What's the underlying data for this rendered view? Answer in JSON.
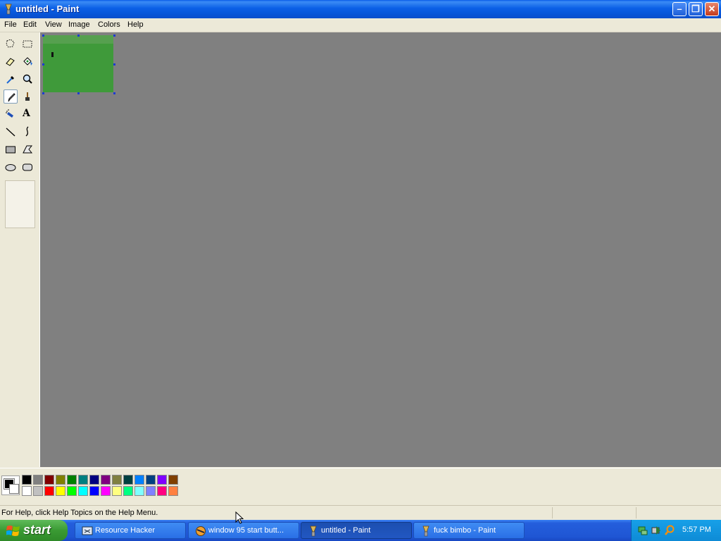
{
  "window": {
    "title": "untitled - Paint",
    "minimize_glyph": "–",
    "restore_glyph": "❐",
    "close_glyph": "✕"
  },
  "menu": [
    "File",
    "Edit",
    "View",
    "Image",
    "Colors",
    "Help"
  ],
  "tools": [
    {
      "name": "free-form-select",
      "icon": "free-form-select-icon"
    },
    {
      "name": "select",
      "icon": "rectangle-select-icon"
    },
    {
      "name": "eraser",
      "icon": "eraser-icon"
    },
    {
      "name": "fill",
      "icon": "paint-bucket-icon"
    },
    {
      "name": "pick-color",
      "icon": "eyedropper-icon"
    },
    {
      "name": "magnifier",
      "icon": "magnifier-icon"
    },
    {
      "name": "pencil",
      "icon": "pencil-icon",
      "selected": true
    },
    {
      "name": "brush",
      "icon": "brush-icon"
    },
    {
      "name": "airbrush",
      "icon": "airbrush-icon"
    },
    {
      "name": "text",
      "icon": "text-icon",
      "glyph": "A"
    },
    {
      "name": "line",
      "icon": "line-icon"
    },
    {
      "name": "curve",
      "icon": "curve-icon"
    },
    {
      "name": "rectangle",
      "icon": "rectangle-icon"
    },
    {
      "name": "polygon",
      "icon": "polygon-icon"
    },
    {
      "name": "ellipse",
      "icon": "ellipse-icon"
    },
    {
      "name": "rounded-rectangle",
      "icon": "rounded-rectangle-icon"
    }
  ],
  "colors": {
    "foreground": "#000000",
    "background": "#ffffff",
    "canvas_fill": "#3f9a3a",
    "workspace": "#808080",
    "palette_top": [
      "#000000",
      "#808080",
      "#800000",
      "#808000",
      "#008000",
      "#008080",
      "#000080",
      "#800080",
      "#808040",
      "#004040",
      "#0080ff",
      "#004080",
      "#8000ff",
      "#804000"
    ],
    "palette_bottom": [
      "#ffffff",
      "#c0c0c0",
      "#ff0000",
      "#ffff00",
      "#00ff00",
      "#00ffff",
      "#0000ff",
      "#ff00ff",
      "#ffff80",
      "#00ff80",
      "#80ffff",
      "#8080ff",
      "#ff0080",
      "#ff8040"
    ]
  },
  "status": {
    "help_text": "For Help, click Help Topics on the Help Menu."
  },
  "taskbar": {
    "start_label": "start",
    "tasks": [
      {
        "label": "Resource Hacker",
        "icon": "resource-hacker-icon",
        "active": false
      },
      {
        "label": "window 95 start butt...",
        "icon": "browser-icon",
        "active": false
      },
      {
        "label": "untitled - Paint",
        "icon": "paint-icon",
        "active": true
      },
      {
        "label": "fuck bimbo - Paint",
        "icon": "paint-icon",
        "active": false
      }
    ],
    "tray_icons": [
      "network-icon",
      "safely-remove-hardware-icon",
      "search-icon"
    ],
    "clock": "5:57 PM"
  }
}
